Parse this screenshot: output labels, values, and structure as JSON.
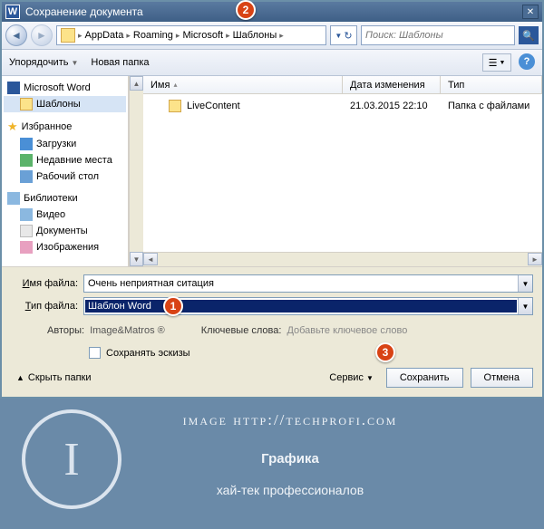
{
  "titlebar": {
    "title": "Сохранение документа"
  },
  "breadcrumb": {
    "segments": [
      "AppData",
      "Roaming",
      "Microsoft",
      "Шаблоны"
    ]
  },
  "search": {
    "placeholder": "Поиск: Шаблоны"
  },
  "toolbar": {
    "organize": "Упорядочить",
    "new_folder": "Новая папка"
  },
  "sidebar": {
    "groups": [
      {
        "label": "Microsoft Word",
        "icon": "word",
        "children": [
          {
            "label": "Шаблоны",
            "icon": "folder",
            "selected": true
          }
        ]
      },
      {
        "label": "Избранное",
        "icon": "star",
        "children": [
          {
            "label": "Загрузки",
            "icon": "blue"
          },
          {
            "label": "Недавние места",
            "icon": "green"
          },
          {
            "label": "Рабочий стол",
            "icon": "desktop"
          }
        ]
      },
      {
        "label": "Библиотеки",
        "icon": "lib",
        "children": [
          {
            "label": "Видео",
            "icon": "lib"
          },
          {
            "label": "Документы",
            "icon": "doc"
          },
          {
            "label": "Изображения",
            "icon": "img"
          }
        ]
      }
    ]
  },
  "columns": {
    "name": "Имя",
    "date": "Дата изменения",
    "type": "Тип"
  },
  "files": [
    {
      "name": "LiveContent",
      "date": "21.03.2015 22:10",
      "type": "Папка с файлами"
    }
  ],
  "form": {
    "filename_label": "Имя файла:",
    "filename_value": "Очень неприятная ситация",
    "filetype_label": "Тип файла:",
    "filetype_value": "Шаблон Word",
    "authors_label": "Авторы:",
    "authors_value": "Image&Matros ®",
    "keywords_label": "Ключевые слова:",
    "keywords_placeholder": "Добавьте ключевое слово",
    "save_thumb": "Сохранять эскизы"
  },
  "actions": {
    "hide_folders": "Скрыть папки",
    "tools": "Сервис",
    "save": "Сохранить",
    "cancel": "Отмена"
  },
  "badges": {
    "b1": "1",
    "b2": "2",
    "b3": "3"
  },
  "watermark": {
    "url": "image http://techprofi.com",
    "line2": "Графика",
    "line3": "хай-тек профессионалов",
    "letter": "I"
  }
}
